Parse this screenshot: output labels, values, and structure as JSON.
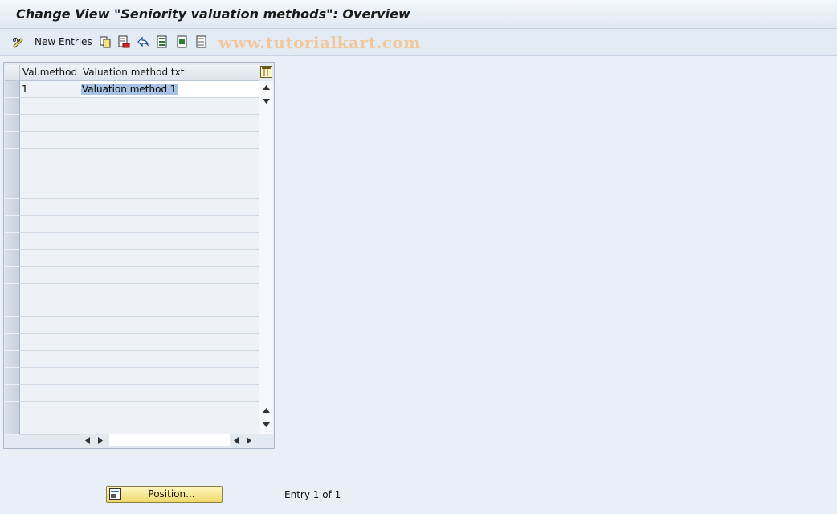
{
  "window": {
    "title": "Change View \"Seniority valuation methods\": Overview"
  },
  "toolbar": {
    "new_entries_label": "New Entries",
    "icons": [
      "pencil-glasses-icon",
      "copy-icon",
      "delete-icon",
      "undo-icon",
      "select-all-icon",
      "select-block-icon",
      "deselect-all-icon"
    ],
    "watermark": "www.tutorialkart.com"
  },
  "table": {
    "columns": [
      "Val.method",
      "Valuation method txt"
    ],
    "rows": [
      {
        "method": "1",
        "text": "Valuation method 1"
      }
    ],
    "visible_row_count": 21
  },
  "footer": {
    "position_label": "Position...",
    "entry_info": "Entry 1 of 1"
  },
  "colors": {
    "background": "#e9eff7",
    "selection": "#a9c3e4",
    "button_yellow": "#f0d86a",
    "watermark": "#f1c79d"
  }
}
